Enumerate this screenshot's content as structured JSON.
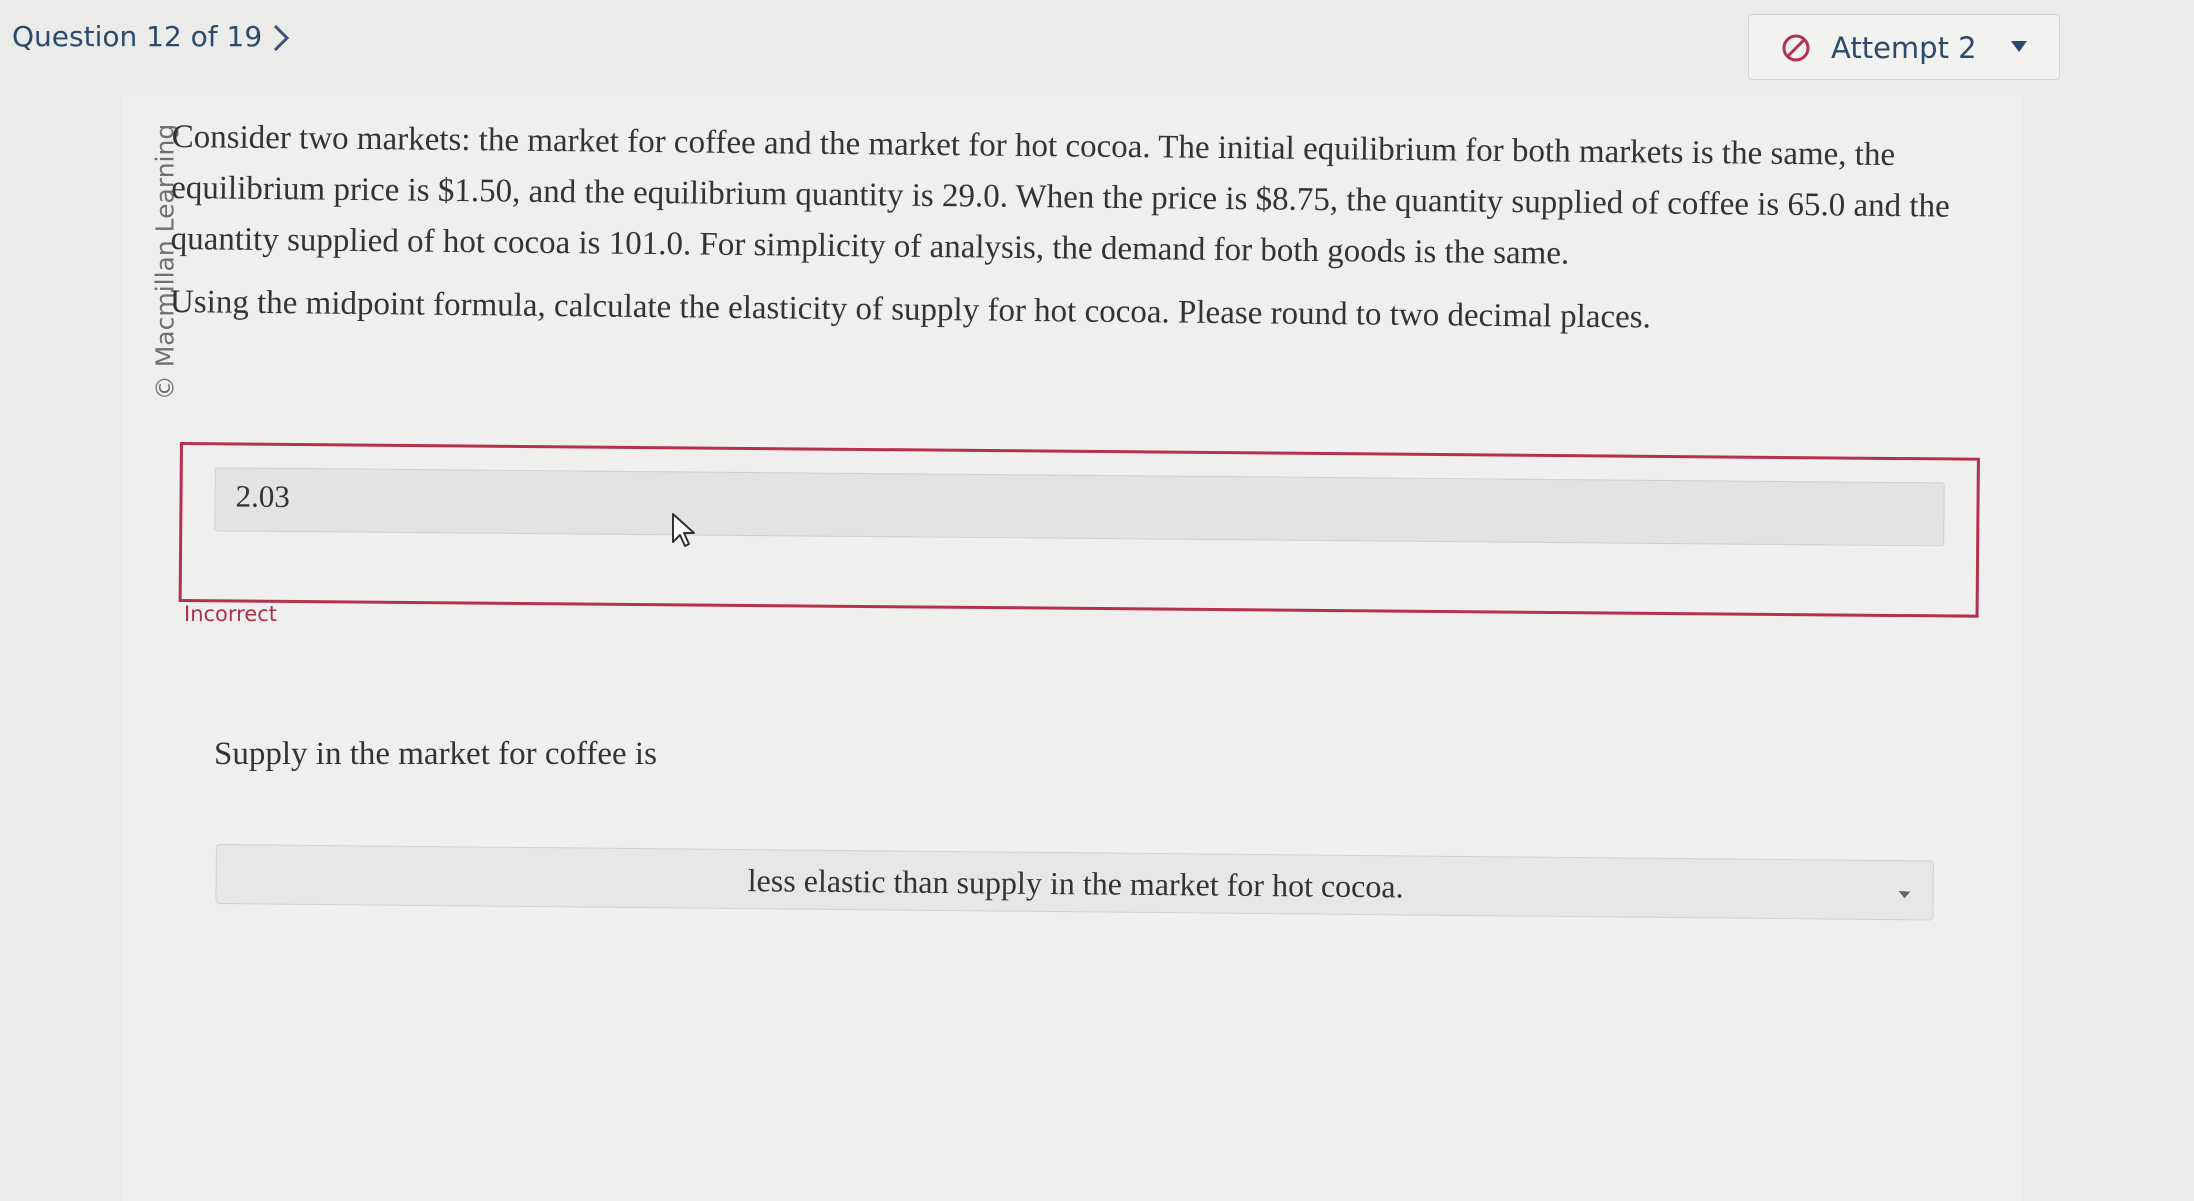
{
  "header": {
    "question_label": "Question 12 of 19",
    "next_icon": "chevron-right-icon",
    "attempt_label": "Attempt 2",
    "attempt_icon": "prohibited-icon",
    "attempt_dropdown_icon": "caret-down-icon"
  },
  "question": {
    "credit": "© Macmillan Learning",
    "paragraph_1": "Consider two markets: the market for coffee and the market for hot cocoa. The initial equilibrium for both markets is the same, the equilibrium price is $1.50, and the equilibrium quantity is 29.0. When the price is $8.75, the quantity supplied of coffee is 65.0 and the quantity supplied of hot cocoa is 101.0. For simplicity of analysis, the demand for both goods is the same.",
    "paragraph_2": "Using the midpoint formula, calculate the elasticity of supply for hot cocoa. Please round to two decimal places."
  },
  "answer": {
    "value": "2.03",
    "feedback": "Incorrect"
  },
  "part2": {
    "prompt": "Supply in the market for coffee is",
    "selected": "less elastic than supply in the market for hot cocoa."
  },
  "colors": {
    "incorrect": "#b5314a",
    "header_text": "#2c4a6b"
  }
}
